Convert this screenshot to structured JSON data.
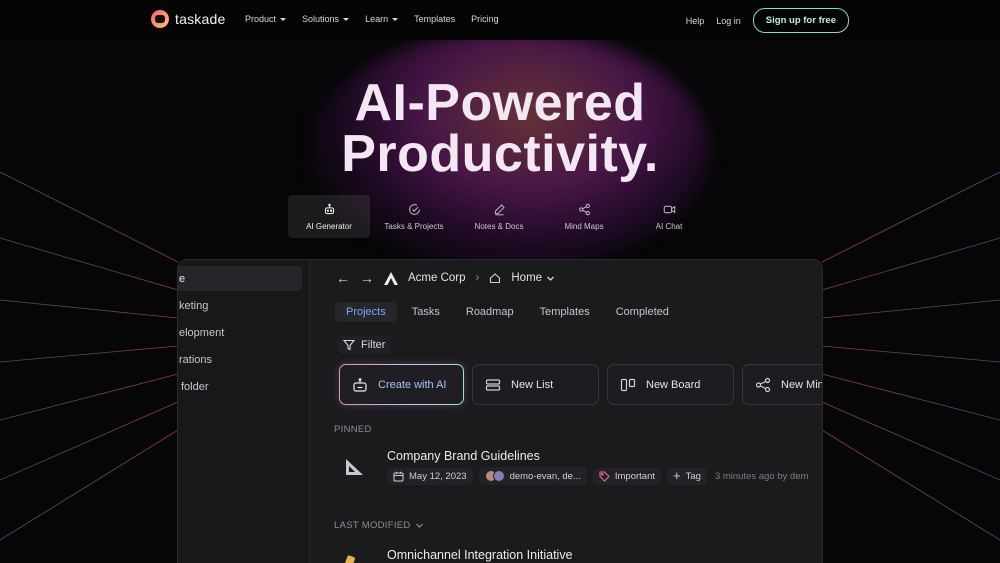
{
  "brand": {
    "name": "taskade"
  },
  "nav": {
    "links": [
      {
        "label": "Product",
        "dropdown": true
      },
      {
        "label": "Solutions",
        "dropdown": true
      },
      {
        "label": "Learn",
        "dropdown": true
      },
      {
        "label": "Templates",
        "dropdown": false
      },
      {
        "label": "Pricing",
        "dropdown": false
      }
    ],
    "help": "Help",
    "login": "Log in",
    "signup": "Sign up for free"
  },
  "hero": {
    "line1": "AI-Powered",
    "line2": "Productivity."
  },
  "feature_tabs": [
    {
      "label": "AI Generator",
      "icon": "robot-icon",
      "active": true
    },
    {
      "label": "Tasks & Projects",
      "icon": "check-circle-icon",
      "active": false
    },
    {
      "label": "Notes & Docs",
      "icon": "pen-icon",
      "active": false
    },
    {
      "label": "Mind Maps",
      "icon": "share-nodes-icon",
      "active": false
    },
    {
      "label": "AI Chat",
      "icon": "video-icon",
      "active": false
    }
  ],
  "app": {
    "sidebar": [
      {
        "label": "e",
        "active": true
      },
      {
        "label": "keting",
        "active": false
      },
      {
        "label": "elopment",
        "active": false
      },
      {
        "label": "rations",
        "active": false
      },
      {
        "label": "folder",
        "active": false
      }
    ],
    "breadcrumb": {
      "workspace": "Acme Corp",
      "page": "Home"
    },
    "tabs": [
      {
        "label": "Projects",
        "active": true
      },
      {
        "label": "Tasks",
        "active": false
      },
      {
        "label": "Roadmap",
        "active": false
      },
      {
        "label": "Templates",
        "active": false
      },
      {
        "label": "Completed",
        "active": false
      }
    ],
    "filter_label": "Filter",
    "actions": [
      {
        "label": "Create with AI",
        "icon": "robot-icon"
      },
      {
        "label": "New List",
        "icon": "list-icon"
      },
      {
        "label": "New Board",
        "icon": "board-icon"
      },
      {
        "label": "New Mind",
        "icon": "mindmap-icon"
      }
    ],
    "pinned_label": "PINNED",
    "pinned_project": {
      "title": "Company Brand Guidelines",
      "date": "May 12, 2023",
      "members": "demo-evan, de...",
      "tag": "Important",
      "add_tag": "Tag",
      "updated": "3 minutes ago by dem"
    },
    "last_modified_label": "LAST MODIFIED",
    "recent_project": {
      "title": "Omnichannel Integration Initiative"
    }
  },
  "colors": {
    "accent_blue": "#7da6ff",
    "signup_border": "#7fe0c2",
    "tag_pink": "#e86a9a"
  }
}
